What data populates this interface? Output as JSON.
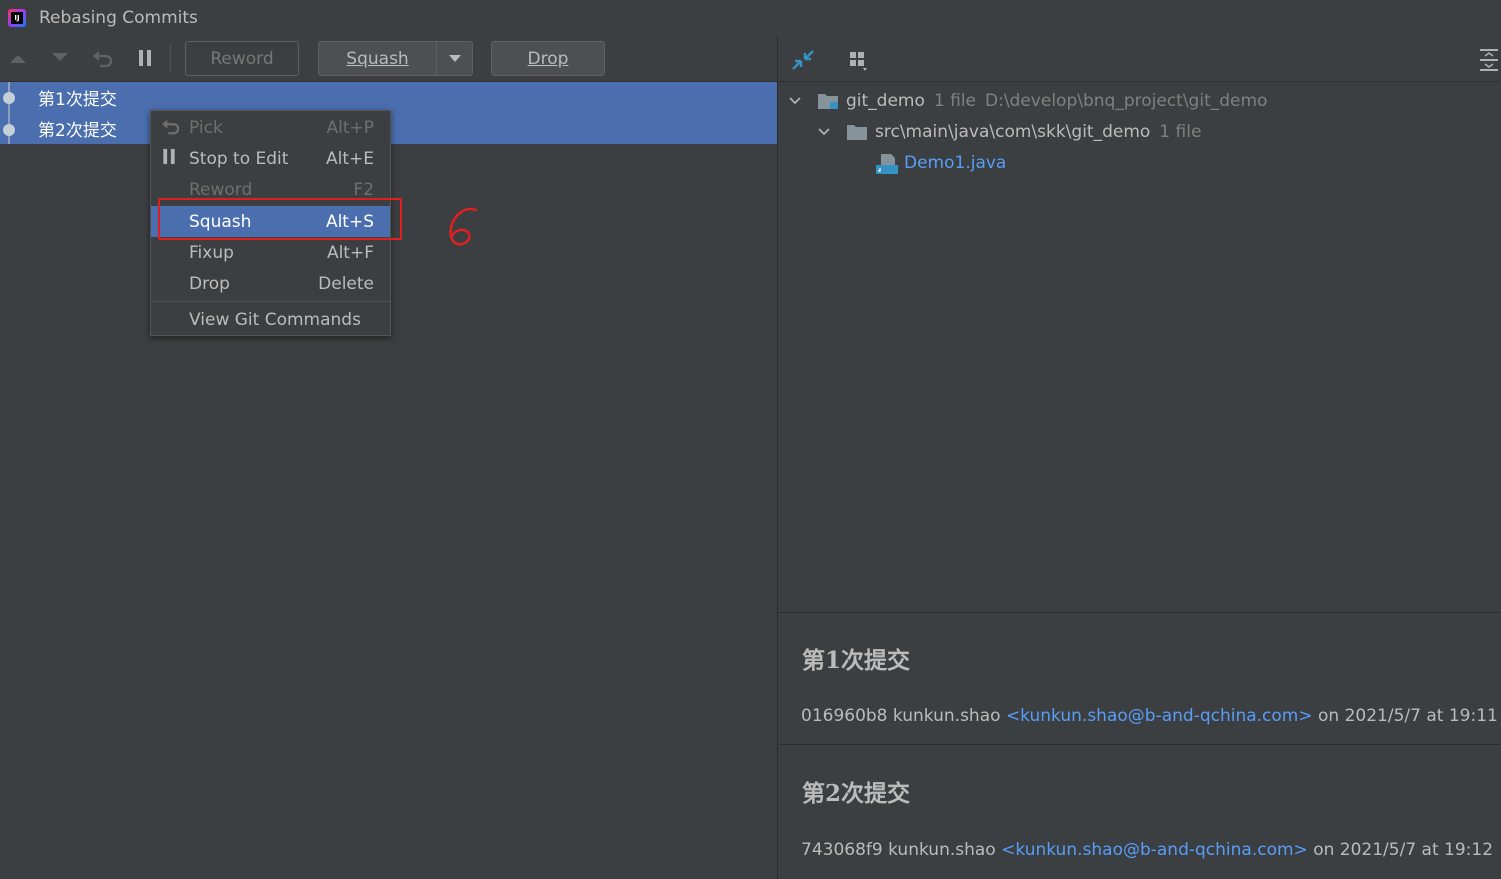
{
  "window": {
    "title": "Rebasing Commits",
    "logo_text": "IJ"
  },
  "toolbar": {
    "move_up_icon": "arrow-up-icon",
    "move_down_icon": "arrow-down-icon",
    "undo_icon": "undo-icon",
    "pause_icon": "pause-icon",
    "reword_label": "Reword",
    "squash_label": "Squash",
    "drop_label": "Drop"
  },
  "commits": [
    {
      "label": "第1次提交"
    },
    {
      "label": "第2次提交"
    }
  ],
  "context_menu": {
    "items": [
      {
        "label": "Pick",
        "shortcut": "Alt+P",
        "enabled": false,
        "icon": "undo-icon"
      },
      {
        "label": "Stop to Edit",
        "shortcut": "Alt+E",
        "enabled": true,
        "icon": "pause-icon"
      },
      {
        "label": "Reword",
        "shortcut": "F2",
        "enabled": false
      },
      {
        "label": "Squash",
        "shortcut": "Alt+S",
        "enabled": true,
        "selected": true
      },
      {
        "label": "Fixup",
        "shortcut": "Alt+F",
        "enabled": true
      },
      {
        "label": "Drop",
        "shortcut": "Delete",
        "enabled": true
      },
      {
        "label": "View Git Commands",
        "shortcut": "",
        "enabled": true
      }
    ]
  },
  "annotation": {
    "step_number": "6",
    "color": "#e02020"
  },
  "changes_tree": {
    "root": {
      "name": "git_demo",
      "count": "1 file",
      "path": "D:\\develop\\bnq_project\\git_demo"
    },
    "folder": {
      "name": "src\\main\\java\\com\\skk\\git_demo",
      "count": "1 file"
    },
    "file": {
      "name": "Demo1.java"
    }
  },
  "details": [
    {
      "title": "第1次提交",
      "hash": "016960b8",
      "author": "kunkun.shao",
      "email": "<kunkun.shao@b-and-qchina.com>",
      "date": "on 2021/5/7 at 19:11"
    },
    {
      "title": "第2次提交",
      "hash": "743068f9",
      "author": "kunkun.shao",
      "email": "<kunkun.shao@b-and-qchina.com>",
      "date": "on 2021/5/7 at 19:12"
    }
  ],
  "colors": {
    "background": "#3c3f41",
    "selection": "#4b6eaf",
    "link": "#589df6",
    "text": "#bbbbbb"
  }
}
